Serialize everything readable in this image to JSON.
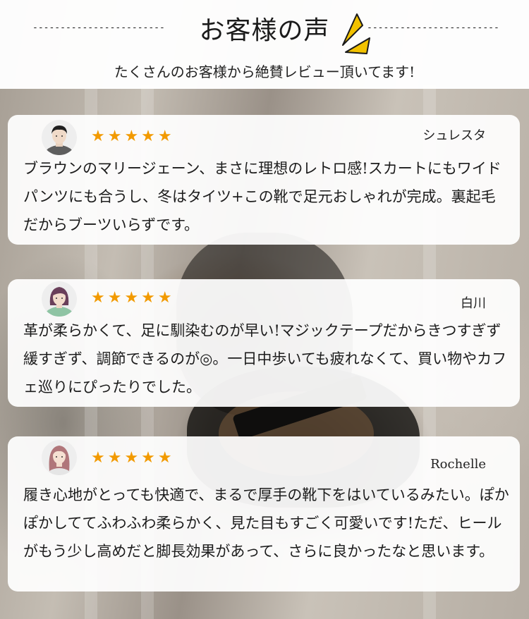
{
  "header": {
    "title": "お客様の声",
    "subtitle": "たくさんのお客様から絶賛レビュー頂いてます!",
    "dash_left": "-------------------------",
    "dash_right": "-------------------------",
    "accent_color": "#f2c200"
  },
  "rating_color": "#f29a00",
  "reviews": [
    {
      "name": "シュレスタ",
      "stars": "★★★★★",
      "avatar": "man-avatar",
      "text": "ブラウンのマリージェーン、まさに理想のレトロ感!スカートにもワイドパンツにも合うし、冬はタイツ+この靴で足元おしゃれが完成。裏起毛だからブーツいらずです。"
    },
    {
      "name": "白川",
      "stars": "★★★★★",
      "avatar": "woman-avatar",
      "text": "革が柔らかくて、足に馴染むのが早い!マジックテープだからきつすぎず緩すぎず、調節できるのが◎。一日中歩いても疲れなくて、買い物やカフェ巡りにぴったりでした。"
    },
    {
      "name": "Rochelle",
      "stars": "★★★★★",
      "avatar": "woman-long-hair-avatar",
      "text": "履き心地がとっても快適で、まるで厚手の靴下をはいているみたい。ぽかぽかしててふわふわ柔らかく、見た目もすごく可愛いです!ただ、ヒールがもう少し高めだと脚長効果があって、さらに良かったなと思います。"
    }
  ]
}
